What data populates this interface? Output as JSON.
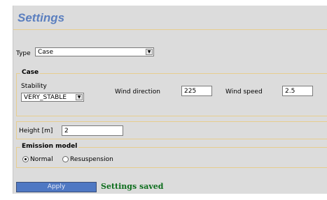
{
  "title": "Settings",
  "type_field": {
    "label": "Type",
    "value": "Case"
  },
  "case_group": {
    "legend": "Case",
    "stability_label": "Stability",
    "stability_value": "VERY_STABLE",
    "wind_direction_label": "Wind direction",
    "wind_direction_value": "225",
    "wind_speed_label": "Wind speed",
    "wind_speed_value": "2.5"
  },
  "height_field": {
    "label": "Height [m]",
    "value": "2"
  },
  "emission_group": {
    "legend": "Emission model",
    "options": [
      {
        "label": "Normal",
        "checked": true
      },
      {
        "label": "Resuspension",
        "checked": false
      }
    ]
  },
  "apply_label": "Apply",
  "status_text": "Settings saved",
  "colors": {
    "title": "#5b7fbf",
    "accent_line": "#e7cd8e",
    "button": "#4f78c3",
    "status": "#0c6d1c",
    "panel": "#dcdcdc"
  },
  "icons": {
    "dropdown": "chevron-down-icon"
  }
}
